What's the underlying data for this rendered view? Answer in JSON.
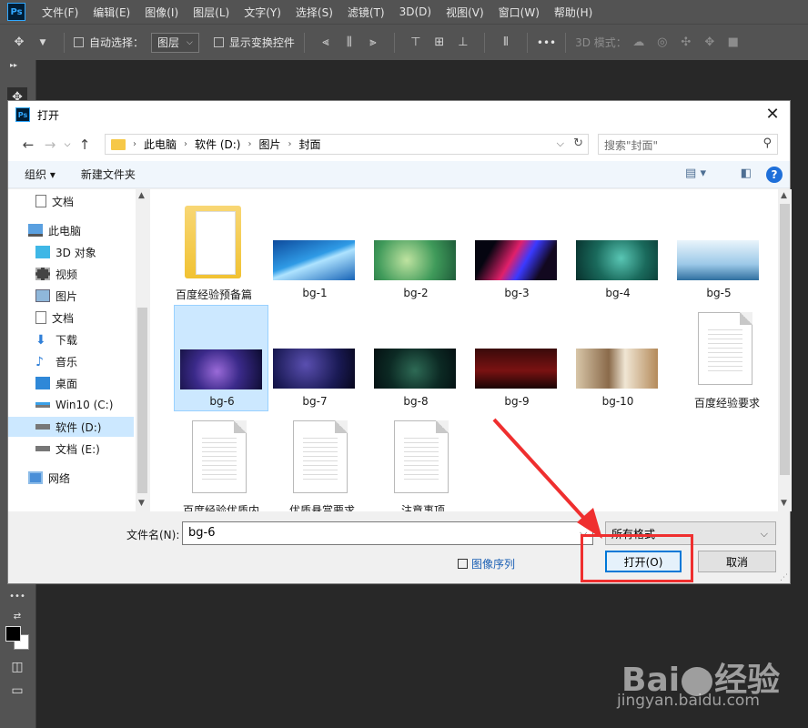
{
  "menubar": {
    "logo": "Ps",
    "items": [
      "文件(F)",
      "编辑(E)",
      "图像(I)",
      "图层(L)",
      "文字(Y)",
      "选择(S)",
      "滤镜(T)",
      "3D(D)",
      "视图(V)",
      "窗口(W)",
      "帮助(H)"
    ]
  },
  "options": {
    "auto_select_label": "自动选择：",
    "layer_select": "图层",
    "show_transform_label": "显示变换控件",
    "more": "•••",
    "mode_3d_label": "3D 模式："
  },
  "dialog": {
    "title": "打开",
    "breadcrumb": [
      "此电脑",
      "软件 (D:)",
      "图片",
      "封面"
    ],
    "search_placeholder": "搜索\"封面\"",
    "organize_label": "组织 ▾",
    "new_folder_label": "新建文件夹",
    "help_glyph": "?",
    "nav_items": [
      {
        "label": "文档",
        "icon": "document-icon"
      },
      {
        "label": "此电脑",
        "icon": "computer-icon"
      },
      {
        "label": "3D 对象",
        "icon": "3d-objects-icon"
      },
      {
        "label": "视频",
        "icon": "video-icon"
      },
      {
        "label": "图片",
        "icon": "pictures-icon"
      },
      {
        "label": "文档",
        "icon": "document-icon"
      },
      {
        "label": "下载",
        "icon": "download-icon"
      },
      {
        "label": "音乐",
        "icon": "music-icon"
      },
      {
        "label": "桌面",
        "icon": "desktop-icon"
      },
      {
        "label": "Win10 (C:)",
        "icon": "drive-icon"
      },
      {
        "label": "软件 (D:)",
        "icon": "drive-icon"
      },
      {
        "label": "文档 (E:)",
        "icon": "drive-icon"
      },
      {
        "label": "网络",
        "icon": "network-icon"
      }
    ],
    "files": [
      {
        "name": "百度经验预备篇",
        "kind": "folder"
      },
      {
        "name": "bg-1",
        "kind": "image"
      },
      {
        "name": "bg-2",
        "kind": "image"
      },
      {
        "name": "bg-3",
        "kind": "image"
      },
      {
        "name": "bg-4",
        "kind": "image"
      },
      {
        "name": "bg-5",
        "kind": "image"
      },
      {
        "name": "bg-6",
        "kind": "image",
        "selected": true
      },
      {
        "name": "bg-7",
        "kind": "image"
      },
      {
        "name": "bg-8",
        "kind": "image"
      },
      {
        "name": "bg-9",
        "kind": "image"
      },
      {
        "name": "bg-10",
        "kind": "image"
      },
      {
        "name": "百度经验要求",
        "kind": "document"
      },
      {
        "name": "百度经验优质内",
        "kind": "document"
      },
      {
        "name": "优质悬赏要求",
        "kind": "document"
      },
      {
        "name": "注意事项",
        "kind": "document"
      }
    ],
    "filename_label": "文件名(N):",
    "filename_value": "bg-6",
    "filetype_value": "所有格式",
    "image_sequence_label": "图像序列",
    "open_button": "打开(O)",
    "cancel_button": "取消"
  },
  "watermark": {
    "logo": "Bai都经验",
    "url": "jingyan.baidu.com"
  },
  "colors": {
    "accent": "#0078d7",
    "highlight": "#ef2f2f",
    "selection": "#cce8ff"
  }
}
